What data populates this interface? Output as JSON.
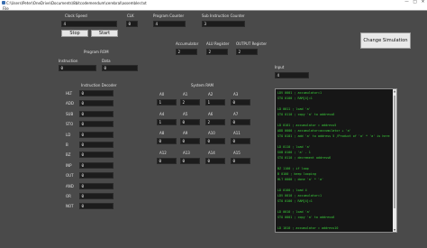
{
  "window": {
    "title": "C:\\Users\\Peter\\OneDrive\\Documents\\8bitcodemendum\\cerebral\\assembler.txt",
    "minimize": "—",
    "maximize": "□",
    "close": "✕"
  },
  "menu": {
    "file": "File"
  },
  "clock": {
    "label": "Clock Speed",
    "value": "4"
  },
  "clk": {
    "label": "CLK",
    "value": "0"
  },
  "program_counter": {
    "label": "Program Counter",
    "value": "4"
  },
  "sub_instruction_counter": {
    "label": "Sub Instruction Counter",
    "value": "3"
  },
  "buttons": {
    "stop": "Stop",
    "start": "Start",
    "change_simulation": "Change Simulation"
  },
  "program_rom": {
    "title": "Program ROM",
    "instruction_label": "Instruction",
    "instruction_value": "0",
    "data_label": "Data",
    "data_value": "0"
  },
  "registers": {
    "accumulator_label": "Accumulator",
    "accumulator_value": "2",
    "alu_label": "ALU Register",
    "alu_value": "2",
    "output_label": "OUTPUT Register",
    "output_value": "2"
  },
  "input": {
    "label": "Input",
    "value": "4"
  },
  "decoder": {
    "title": "Instruction Decoder",
    "rows": [
      {
        "name": "HLT",
        "value": "0"
      },
      {
        "name": "ADD",
        "value": "0"
      },
      {
        "name": "SUB",
        "value": "0"
      },
      {
        "name": "STO",
        "value": "0"
      },
      {
        "name": "LD",
        "value": "0"
      },
      {
        "name": "B",
        "value": "0"
      },
      {
        "name": "BZ",
        "value": "0"
      },
      {
        "name": "INP",
        "value": "0"
      },
      {
        "name": "OUT",
        "value": "0"
      },
      {
        "name": "AND",
        "value": "0"
      },
      {
        "name": "OR",
        "value": "0"
      },
      {
        "name": "NOT",
        "value": "0"
      }
    ]
  },
  "system_ram": {
    "title": "System RAM",
    "cells": [
      {
        "label": "A0",
        "value": "1"
      },
      {
        "label": "A1",
        "value": "2"
      },
      {
        "label": "A2",
        "value": "1"
      },
      {
        "label": "A3",
        "value": "0"
      },
      {
        "label": "A4",
        "value": "1"
      },
      {
        "label": "A5",
        "value": "0"
      },
      {
        "label": "A6",
        "value": "2"
      },
      {
        "label": "A7",
        "value": "0"
      },
      {
        "label": "A8",
        "value": "0"
      },
      {
        "label": "A9",
        "value": "0"
      },
      {
        "label": "A10",
        "value": "0"
      },
      {
        "label": "A11",
        "value": "0"
      },
      {
        "label": "A12",
        "value": "0"
      },
      {
        "label": "A13",
        "value": "0"
      },
      {
        "label": "A14",
        "value": "0"
      },
      {
        "label": "A15",
        "value": "0"
      }
    ]
  },
  "console": {
    "lines": [
      "LDV 0001   ; accumulator=1",
      "STO 0100   ; RAM[4]=1",
      "",
      "LD 0011    ; load 'a'",
      "STO 0110   ; copy 'a' to address6",
      "",
      "LD 0101    ; accumulator = address5",
      "ADD 0000   ; accumulator=accumulator + 'a'",
      "STO 0101   ; add 'a' to address 5 /Product of 'a' * 'a' is here",
      "",
      "LD 0110    ; load 'a'",
      "SUB 0100   ; 'a' - 1",
      "STO 0110   ; decrement address6",
      "",
      "BZ 1100    ; if loop",
      "B 0100     ; keep looping",
      "HLT 0000   ; done 'a' * 'a'",
      "",
      "LD 0100    ; load 4",
      "LDV 0010   ; accumulator=1",
      "STO 0100   ; RAM[4]=1",
      "",
      "LD 0010    ; load 'a'",
      "STO 0001   ; copy 'a' to address6",
      "",
      "LD 1010    ; accumulator = address10"
    ]
  }
}
